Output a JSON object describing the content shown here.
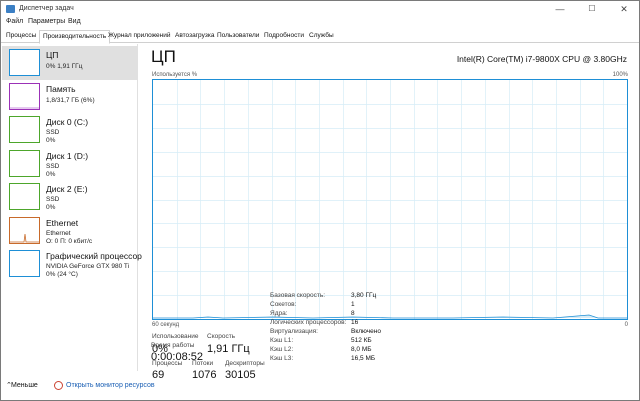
{
  "window": {
    "title": "Диспетчер задач",
    "minimize": "—",
    "maximize": "☐",
    "close": "✕"
  },
  "menu": [
    "Файл",
    "Параметры",
    "Вид"
  ],
  "tabs": [
    "Процессы",
    "Производительность",
    "Журнал приложений",
    "Автозагрузка",
    "Пользователи",
    "Подробности",
    "Службы"
  ],
  "active_tab": "Производительность",
  "sidebar": [
    {
      "name": "ЦП",
      "line1": "0% 1,91 ГГц",
      "line2": "",
      "color": "#1e8fd6"
    },
    {
      "name": "Память",
      "line1": "1,8/31,7 ГБ (6%)",
      "line2": "",
      "color": "#9b31b7"
    },
    {
      "name": "Диск 0 (C:)",
      "line1": "SSD",
      "line2": "0%",
      "color": "#4da62b"
    },
    {
      "name": "Диск 1 (D:)",
      "line1": "SSD",
      "line2": "0%",
      "color": "#4da62b"
    },
    {
      "name": "Диск 2 (E:)",
      "line1": "SSD",
      "line2": "0%",
      "color": "#4da62b"
    },
    {
      "name": "Ethernet",
      "line1": "Ethernet",
      "line2": "О: 0 П: 0 кбит/с",
      "color": "#c86a2a"
    },
    {
      "name": "Графический процессор",
      "line1": "NVIDIA GeForce GTX 980 Ti",
      "line2": "0% (24 °C)",
      "color": "#1e8fd6"
    }
  ],
  "main": {
    "title": "ЦП",
    "cpu_name": "Intel(R) Core(TM) i7-9800X CPU @ 3.80GHz",
    "graph_label": "Используется %",
    "graph_max": "100%",
    "graph_time": "60 секунд",
    "graph_min": "0"
  },
  "stats": {
    "usage_label": "Использование",
    "usage": "0%",
    "speed_label": "Скорость",
    "speed": "1,91 ГГц",
    "proc_label": "Процессы",
    "proc": "69",
    "threads_label": "Потоки",
    "threads": "1076",
    "handles_label": "Дескрипторы",
    "handles": "30105",
    "uptime_label": "Время работы",
    "uptime": "0:00:08:52"
  },
  "details": [
    {
      "k": "Базовая скорость:",
      "v": "3,80 ГГц"
    },
    {
      "k": "Сокетов:",
      "v": "1"
    },
    {
      "k": "Ядра:",
      "v": "8"
    },
    {
      "k": "Логических процессоров:",
      "v": "16"
    },
    {
      "k": "Виртуализация:",
      "v": "Включено"
    },
    {
      "k": "Кэш L1:",
      "v": "512 КБ"
    },
    {
      "k": "Кэш L2:",
      "v": "8,0 МБ"
    },
    {
      "k": "Кэш L3:",
      "v": "16,5 МБ"
    }
  ],
  "footer": {
    "less": "Меньше",
    "monitor": "Открыть монитор ресурсов"
  },
  "colors": {
    "accent": "#1e8fd6",
    "grid": "#d6ecf7"
  }
}
